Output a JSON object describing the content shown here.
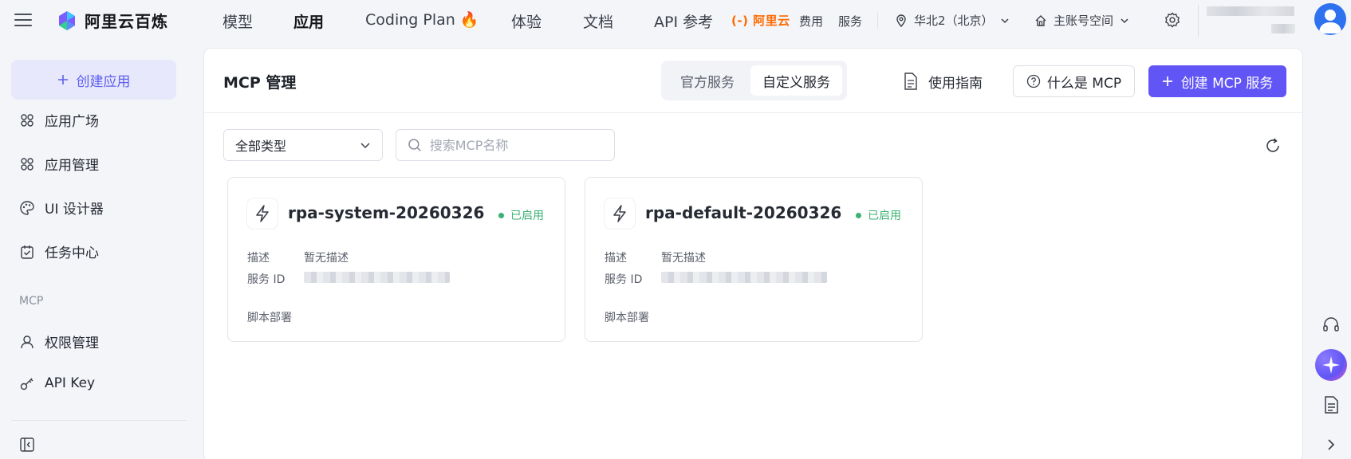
{
  "brand": {
    "name": "阿里云百炼"
  },
  "topnav": {
    "items": [
      "模型",
      "应用",
      "Coding Plan",
      "体验",
      "文档",
      "API 参考"
    ],
    "active": "应用",
    "aliyun_label": "(-) 阿里云",
    "fee": "费用",
    "service": "服务",
    "region": "华北2（北京）",
    "workspace": "主账号空间"
  },
  "sidebar": {
    "create_app": "创建应用",
    "items": [
      {
        "label": "应用广场",
        "icon": "grid-icon"
      },
      {
        "label": "应用管理",
        "icon": "grid-icon"
      },
      {
        "label": "UI 设计器",
        "icon": "palette-icon"
      },
      {
        "label": "任务中心",
        "icon": "task-icon"
      }
    ],
    "section_mcp": "MCP",
    "items2": [
      {
        "label": "权限管理",
        "icon": "user-icon"
      },
      {
        "label": "API Key",
        "icon": "key-icon"
      }
    ]
  },
  "panel": {
    "title": "MCP 管理",
    "tabs": [
      "官方服务",
      "自定义服务"
    ],
    "active_tab": "自定义服务",
    "guide": "使用指南",
    "what_is": "什么是 MCP",
    "create": "创建 MCP 服务",
    "filter_value": "全部类型",
    "search_placeholder": "搜索MCP名称"
  },
  "cards": [
    {
      "name": "rpa-system-20260326",
      "status": "已启用",
      "desc_label": "描述",
      "desc_value": "暂无描述",
      "id_label": "服务 ID",
      "deploy": "脚本部署"
    },
    {
      "name": "rpa-default-20260326",
      "status": "已启用",
      "desc_label": "描述",
      "desc_value": "暂无描述",
      "id_label": "服务 ID",
      "deploy": "脚本部署"
    }
  ],
  "colors": {
    "accent": "#6155f5",
    "status_green": "#3bb273",
    "brand_orange": "#ff6a00"
  }
}
